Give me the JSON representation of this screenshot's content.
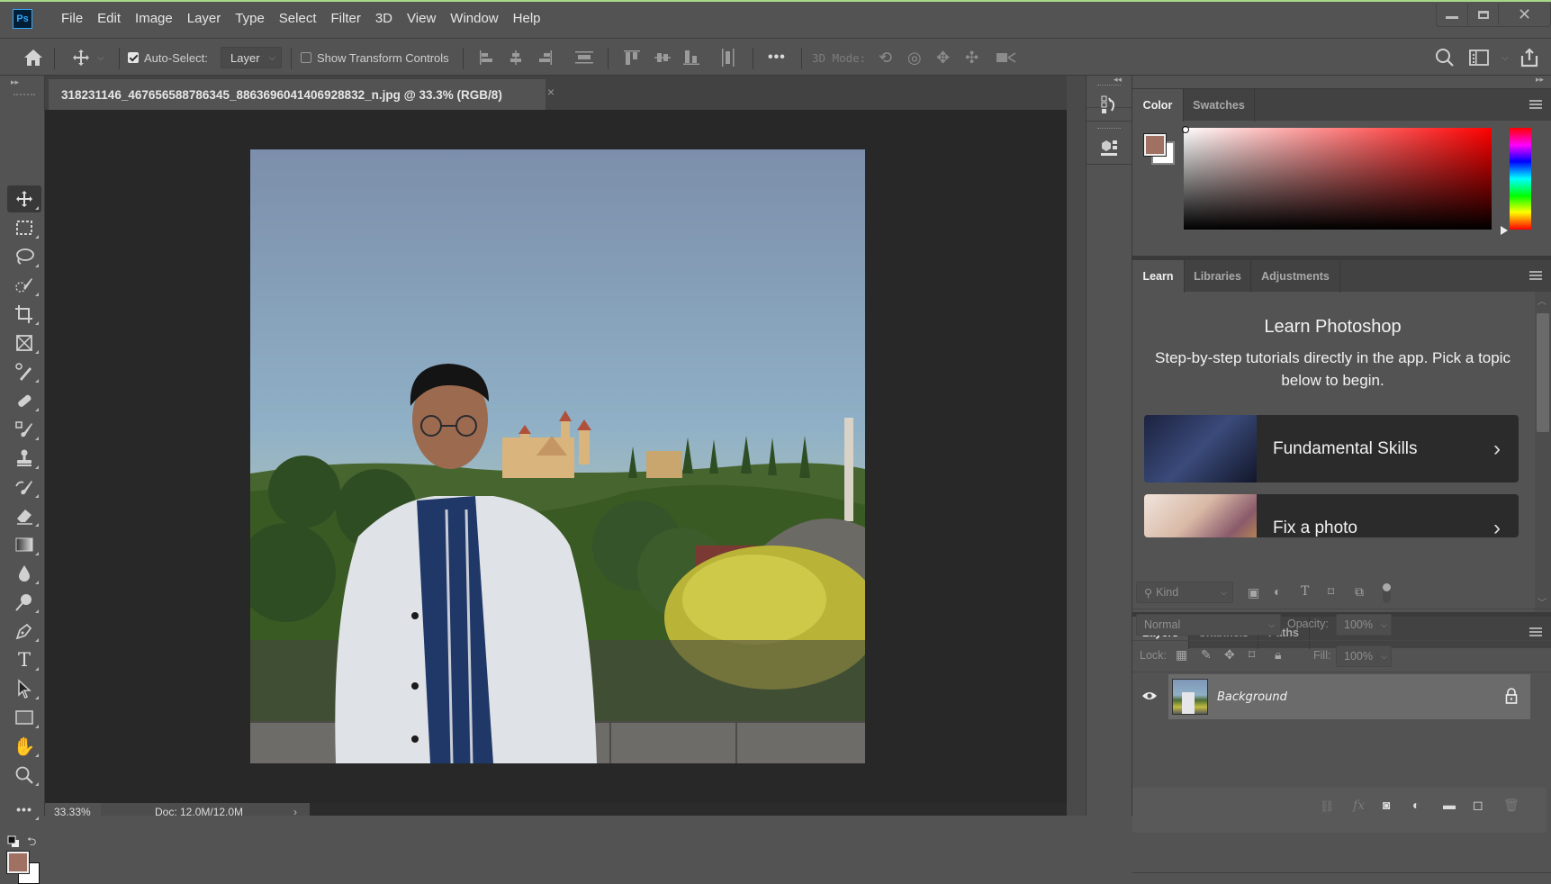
{
  "app": {
    "logo": "Ps",
    "name": "Adobe Photoshop"
  },
  "menu": [
    "File",
    "Edit",
    "Image",
    "Layer",
    "Type",
    "Select",
    "Filter",
    "3D",
    "View",
    "Window",
    "Help"
  ],
  "window_controls": {
    "minimize": "minimize-icon",
    "maximize": "maximize-icon",
    "close": "close-icon"
  },
  "options_bar": {
    "auto_select_label": "Auto-Select:",
    "auto_select_checked": true,
    "auto_select_target": "Layer",
    "show_transform_label": "Show Transform Controls",
    "show_transform_checked": false,
    "more_label": "•••",
    "mode_3d_label": "3D Mode:",
    "align_icons": [
      "align-left-edges",
      "align-horizontal-centers",
      "align-right-edges",
      "distribute-horizontal",
      "align-top-edges",
      "align-vertical-centers",
      "align-bottom-edges",
      "distribute-vertical"
    ],
    "mode_3d_icons": [
      "orbit-3d",
      "roll-3d",
      "pan-3d",
      "slide-3d",
      "scale-3d"
    ],
    "right_icons": [
      "search",
      "workspace",
      "share"
    ]
  },
  "document": {
    "tab_title": "318231146_467656588786345_8863696041406928832_n.jpg @ 33.3% (RGB/8)",
    "close_glyph": "×"
  },
  "tools": [
    {
      "name": "move",
      "glyph": "✥",
      "active": true
    },
    {
      "name": "rectangular-marquee",
      "glyph": "⬚"
    },
    {
      "name": "lasso",
      "glyph": "➰"
    },
    {
      "name": "object-selection",
      "glyph": "✎"
    },
    {
      "name": "crop",
      "glyph": "⌗"
    },
    {
      "name": "frame",
      "glyph": "⊠"
    },
    {
      "name": "eyedropper",
      "glyph": "⚲"
    },
    {
      "name": "spot-healing",
      "glyph": "✚"
    },
    {
      "name": "brush",
      "glyph": "🖌"
    },
    {
      "name": "clone-stamp",
      "glyph": "⊥"
    },
    {
      "name": "history-brush",
      "glyph": "↺"
    },
    {
      "name": "eraser",
      "glyph": "⌫"
    },
    {
      "name": "gradient",
      "glyph": "▥"
    },
    {
      "name": "blur",
      "glyph": "💧"
    },
    {
      "name": "dodge",
      "glyph": "⚲"
    },
    {
      "name": "pen",
      "glyph": "✒"
    },
    {
      "name": "type",
      "glyph": "T"
    },
    {
      "name": "path-selection",
      "glyph": "➤"
    },
    {
      "name": "rectangle",
      "glyph": "▭"
    },
    {
      "name": "hand",
      "glyph": "✋"
    },
    {
      "name": "zoom",
      "glyph": "🔍"
    },
    {
      "name": "edit-toolbar",
      "glyph": "•••"
    }
  ],
  "colors": {
    "foreground": "#a07063",
    "background": "#ffffff",
    "accent_ps": "#31a8ff"
  },
  "status": {
    "zoom": "33.33%",
    "doc": "Doc: 12.0M/12.0M",
    "arrow": "›"
  },
  "dock": [
    "history-icon",
    "3d-panel-icon"
  ],
  "color_panel": {
    "tabs": [
      "Color",
      "Swatches"
    ],
    "active": 0
  },
  "learn_panel": {
    "tabs": [
      "Learn",
      "Libraries",
      "Adjustments"
    ],
    "active": 0,
    "title": "Learn Photoshop",
    "subtitle": "Step-by-step tutorials directly in the app. Pick a topic below to begin.",
    "cards": [
      {
        "label": "Fundamental Skills",
        "chevron": "›"
      },
      {
        "label": "Fix a photo",
        "chevron": "›"
      }
    ]
  },
  "layers_panel": {
    "tabs": [
      "Layers",
      "Channels",
      "Paths"
    ],
    "active": 0,
    "filter_kind": "Kind",
    "blend_mode": "Normal",
    "opacity_label": "Opacity:",
    "opacity": "100%",
    "lock_label": "Lock:",
    "fill_label": "Fill:",
    "fill": "100%",
    "layers": [
      {
        "name": "Background",
        "visible": true,
        "locked": true
      }
    ],
    "footer_icons": [
      "link-layers",
      "add-layer-style",
      "add-mask",
      "new-adjustment-layer",
      "new-group",
      "new-layer",
      "delete-layer"
    ]
  }
}
